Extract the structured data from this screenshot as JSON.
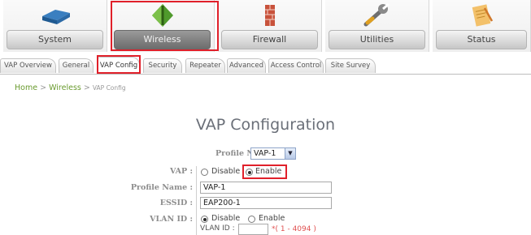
{
  "nav": {
    "items": [
      {
        "label": "System",
        "icon": "device-icon"
      },
      {
        "label": "Wireless",
        "icon": "antenna-icon"
      },
      {
        "label": "Firewall",
        "icon": "firewall-icon"
      },
      {
        "label": "Utilities",
        "icon": "wrench-icon"
      },
      {
        "label": "Status",
        "icon": "notepad-icon"
      }
    ],
    "active": "Wireless"
  },
  "tabs": [
    {
      "label": "VAP Overview"
    },
    {
      "label": "General"
    },
    {
      "label": "VAP Config"
    },
    {
      "label": "Security"
    },
    {
      "label": "Repeater"
    },
    {
      "label": "Advanced"
    },
    {
      "label": "Access Control"
    },
    {
      "label": "Site Survey"
    }
  ],
  "breadcrumb": {
    "home": "Home",
    "sep": ">",
    "section": "Wireless",
    "current": "VAP Config"
  },
  "title": "VAP Configuration",
  "profile_select": {
    "label": "Profile Name :",
    "value": "VAP-1"
  },
  "form": {
    "vap": {
      "label": "VAP :",
      "disable": "Disable",
      "enable": "Enable",
      "selected": "Enable"
    },
    "profile_name": {
      "label": "Profile Name :",
      "value": "VAP-1"
    },
    "essid": {
      "label": "ESSID :",
      "value": "EAP200-1"
    },
    "vlan": {
      "label": "VLAN ID :",
      "disable": "Disable",
      "enable": "Enable",
      "selected": "Disable",
      "id_label": "VLAN ID :",
      "id_value": "",
      "hint": "*( 1 - 4094 )"
    }
  },
  "colors": {
    "highlight": "#e0202a",
    "breadcrumb_link": "#6a9b2f",
    "hint": "#e05050"
  }
}
